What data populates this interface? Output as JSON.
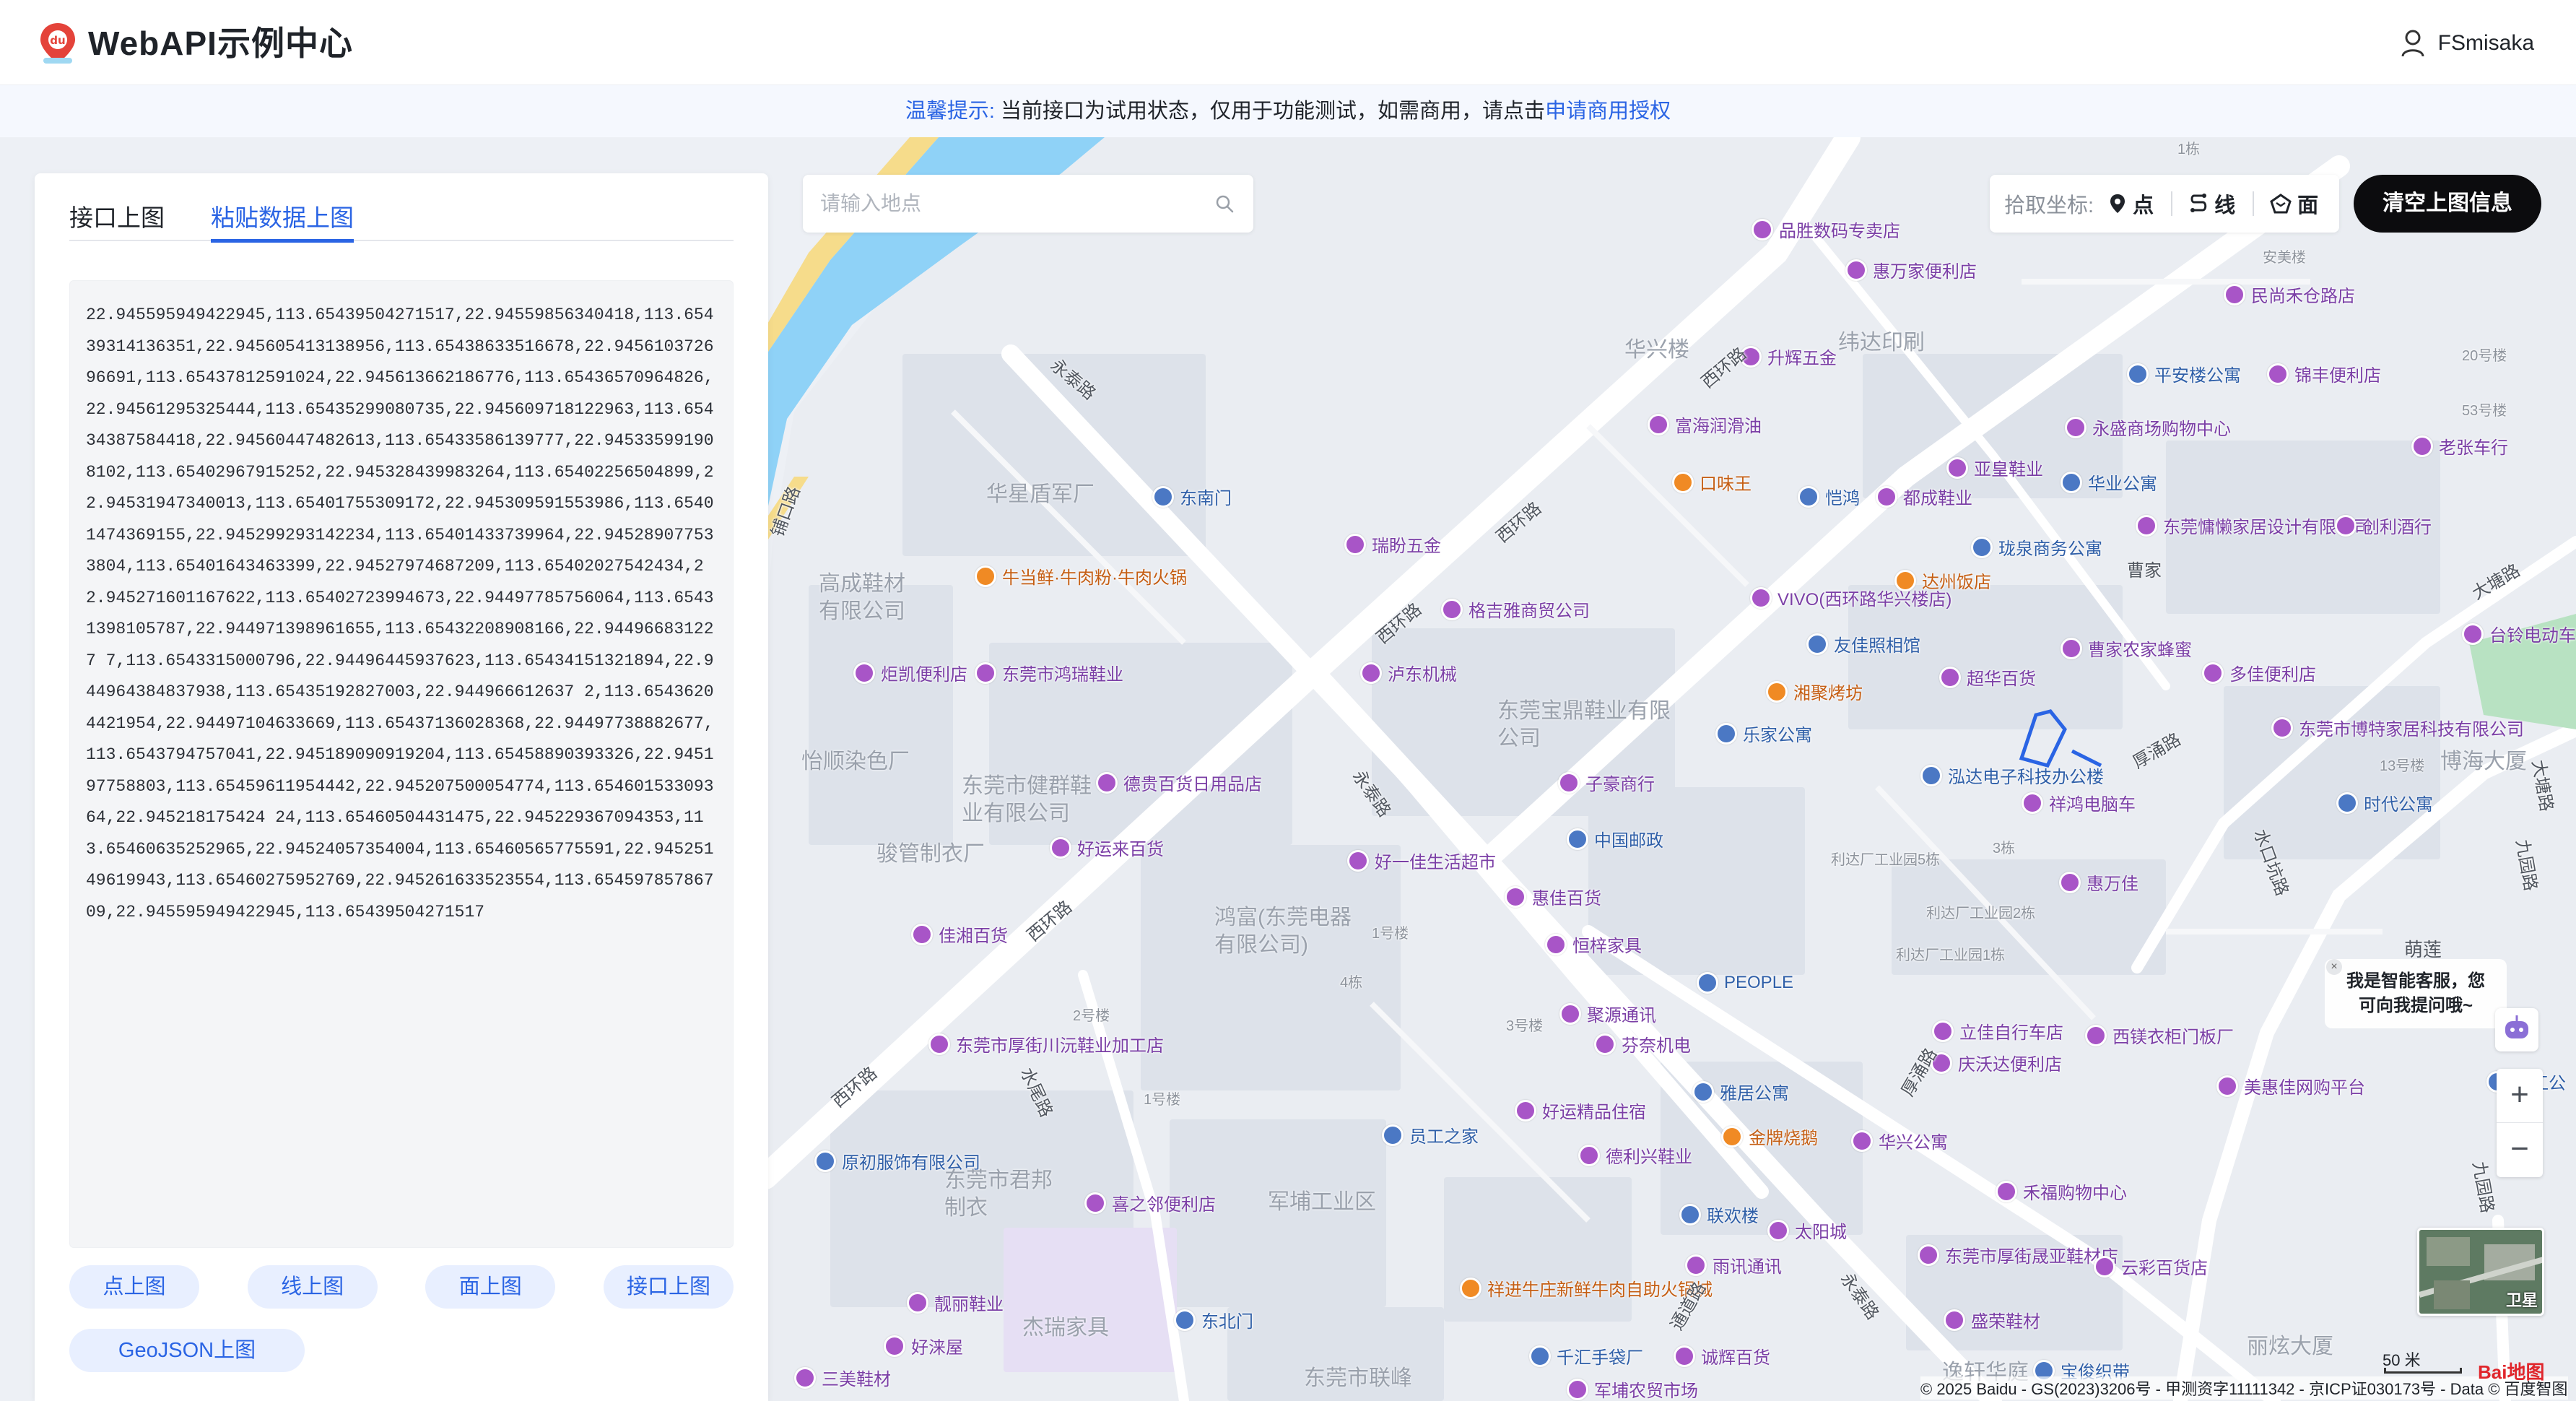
{
  "header": {
    "app_title": "WebAPI示例中心",
    "user_name": "FSmisaka",
    "logo_icon": "baidu-map-pin-icon",
    "user_icon": "user-icon"
  },
  "notice": {
    "label": "温馨提示:",
    "text": "当前接口为试用状态，仅用于功能测试，如需商用，请点击",
    "link": "申请商用授权"
  },
  "panel": {
    "tabs": [
      {
        "label": "接口上图",
        "active": false
      },
      {
        "label": "粘贴数据上图",
        "active": true
      }
    ],
    "coords_text": "22.945595949422945,113.65439504271517,22.94559856340418,113.65439314136351,22.945605413138956,113.65438633516678,22.945610372696691,113.65437812591024,22.945613662186776,113.65436570964826,22.94561295325444,113.65435299080735,22.945609718122963,113.65434387584418,22.94560447482613,113.65433586139777,22.945335991908102,113.65402967915252,22.945328439983264,113.65402256504899,22.94531947340013,113.65401755309172,22.945309591553986,113.65401474369155,22.945299293142234,113.65401433739964,22.945289077533804,113.65401643463399,22.94527974687209,113.65402027542434,22.945271601167622,113.65402723994673,22.94497785756064,113.65431398105787,22.944971398961655,113.65432208908166,22.944966831227 7,113.6543315000796,22.94496445937623,113.65434151321894,22.944964384837938,113.65435192827003,22.944966612637 2,113.65436204421954,22.94497104633669,113.65437136028368,22.94497738882677,113.6543794757041,22.945189090919204,113.65458890393326,22.945197758803,113.65459611954442,22.945207500054774,113.65460153309364,22.945218175424 24,113.65460504431475,22.945229367094353,113.65460635252965,22.94524057354004,113.65460565775591,22.94525149619943,113.65460275952769,22.945261633523554,113.65459785786709,22.945595949422945,113.65439504271517",
    "buttons": [
      "点上图",
      "线上图",
      "面上图",
      "接口上图"
    ],
    "geojson_button": "GeoJSON上图"
  },
  "search": {
    "placeholder": "请输入地点",
    "icon": "search-icon"
  },
  "pick_coords": {
    "label": "拾取坐标:",
    "options": [
      {
        "label": "点",
        "icon": "pin-icon"
      },
      {
        "label": "线",
        "icon": "route-icon"
      },
      {
        "label": "面",
        "icon": "polygon-icon"
      }
    ]
  },
  "clear_button": "清空上图信息",
  "chat_bubble": {
    "line1": "我是智能客服，您",
    "line2": "可向我提问哦~",
    "close": "×"
  },
  "zoom": {
    "in": "+",
    "out": "−"
  },
  "satellite_label": "卫星",
  "scale_label": "50 米",
  "copyright": "© 2025 Baidu - GS(2023)3206号 - 甲测资字11111342 - 京ICP证030173号 - Data © 百度智图",
  "baidu_logo": "Bai地图",
  "map_labels": {
    "pois": [
      {
        "text": "品胜数码专卖店",
        "type": "purple"
      },
      {
        "text": "惠万家便利店",
        "type": "purple"
      },
      {
        "text": "民尚禾仓路店",
        "type": "purple"
      },
      {
        "text": "升辉五金",
        "type": "purple"
      },
      {
        "text": "平安楼公寓",
        "type": "blue"
      },
      {
        "text": "锦丰便利店",
        "type": "purple"
      },
      {
        "text": "富海润滑油",
        "type": "purple"
      },
      {
        "text": "永盛商场购物中心",
        "type": "purple"
      },
      {
        "text": "老张车行",
        "type": "purple"
      },
      {
        "text": "口味王",
        "type": "orange"
      },
      {
        "text": "亚皇鞋业",
        "type": "purple"
      },
      {
        "text": "恺鸿",
        "type": "blue"
      },
      {
        "text": "都成鞋业",
        "type": "purple"
      },
      {
        "text": "华业公寓",
        "type": "blue"
      },
      {
        "text": "东莞慵懒家居设计有限公司",
        "type": "purple"
      },
      {
        "text": "创利酒行",
        "type": "purple"
      },
      {
        "text": "瑞盼五金",
        "type": "purple"
      },
      {
        "text": "珑泉商务公寓",
        "type": "blue"
      },
      {
        "text": "东南门",
        "type": "blue"
      },
      {
        "text": "牛当鲜·牛肉粉·牛肉火锅",
        "type": "orange"
      },
      {
        "text": "VIVO(西环路华兴楼店)",
        "type": "purple"
      },
      {
        "text": "达州饭店",
        "type": "orange"
      },
      {
        "text": "格吉雅商贸公司",
        "type": "purple"
      },
      {
        "text": "台铃电动车",
        "type": "purple"
      },
      {
        "text": "友佳照相馆",
        "type": "blue"
      },
      {
        "text": "炬凯便利店",
        "type": "purple"
      },
      {
        "text": "东莞市鸿瑞鞋业",
        "type": "purple"
      },
      {
        "text": "泸东机械",
        "type": "purple"
      },
      {
        "text": "湘聚烤坊",
        "type": "orange"
      },
      {
        "text": "超华百货",
        "type": "purple"
      },
      {
        "text": "曹家农家蜂蜜",
        "type": "purple"
      },
      {
        "text": "多佳便利店",
        "type": "purple"
      },
      {
        "text": "东莞市博特家居科技有限公司",
        "type": "purple"
      },
      {
        "text": "乐家公寓",
        "type": "blue"
      },
      {
        "text": "德贵百货日用品店",
        "type": "purple"
      },
      {
        "text": "子豪商行",
        "type": "purple"
      },
      {
        "text": "泓达电子科技办公楼",
        "type": "blue"
      },
      {
        "text": "祥鸿电脑车",
        "type": "purple"
      },
      {
        "text": "时代公寓",
        "type": "blue"
      },
      {
        "text": "好运来百货",
        "type": "purple"
      },
      {
        "text": "中国邮政",
        "type": "blue"
      },
      {
        "text": "好一佳生活超市",
        "type": "purple"
      },
      {
        "text": "惠佳百货",
        "type": "purple"
      },
      {
        "text": "惠万佳",
        "type": "purple"
      },
      {
        "text": "佳湘百货",
        "type": "purple"
      },
      {
        "text": "恒梓家具",
        "type": "purple"
      },
      {
        "text": "PEOPLE",
        "type": "blue"
      },
      {
        "text": "聚源通讯",
        "type": "purple"
      },
      {
        "text": "东莞市厚街川沅鞋业加工店",
        "type": "purple"
      },
      {
        "text": "芬奈机电",
        "type": "purple"
      },
      {
        "text": "立佳自行车店",
        "type": "purple"
      },
      {
        "text": "西镁衣柜门板厂",
        "type": "purple"
      },
      {
        "text": "庆沃达便利店",
        "type": "purple"
      },
      {
        "text": "雅居公寓",
        "type": "blue"
      },
      {
        "text": "美惠佳网购平台",
        "type": "purple"
      },
      {
        "text": "丽江公",
        "type": "blue"
      },
      {
        "text": "好运精品住宿",
        "type": "purple"
      },
      {
        "text": "员工之家",
        "type": "blue"
      },
      {
        "text": "原初服饰有限公司",
        "type": "blue"
      },
      {
        "text": "德利兴鞋业",
        "type": "purple"
      },
      {
        "text": "金牌烧鹅",
        "type": "orange"
      },
      {
        "text": "华兴公寓",
        "type": "purple"
      },
      {
        "text": "禾福购物中心",
        "type": "purple"
      },
      {
        "text": "喜之邻便利店",
        "type": "purple"
      },
      {
        "text": "联欢楼",
        "type": "blue"
      },
      {
        "text": "太阳城",
        "type": "purple"
      },
      {
        "text": "东莞市厚街晟亚鞋材店",
        "type": "purple"
      },
      {
        "text": "云彩百货店",
        "type": "purple"
      },
      {
        "text": "雨讯通讯",
        "type": "purple"
      },
      {
        "text": "祥进牛庄新鲜牛肉自助火锅城",
        "type": "orange"
      },
      {
        "text": "靓丽鞋业",
        "type": "purple"
      },
      {
        "text": "东北门",
        "type": "blue"
      },
      {
        "text": "盛荣鞋材",
        "type": "purple"
      },
      {
        "text": "好涞屋",
        "type": "purple"
      },
      {
        "text": "千汇手袋厂",
        "type": "blue"
      },
      {
        "text": "诚辉百货",
        "type": "purple"
      },
      {
        "text": "宝俊织带",
        "type": "blue"
      },
      {
        "text": "三美鞋材",
        "type": "purple"
      },
      {
        "text": "军埔农贸市场",
        "type": "purple"
      }
    ],
    "areas": [
      "华兴楼",
      "纬达印刷",
      "华星盾军厂",
      "高成鞋材有限公司",
      "东莞宝鼎鞋业有限公司",
      "怡顺染色厂",
      "东莞市健群鞋业有限公司",
      "骏管制衣厂",
      "鸿富(东莞电器有限公司)",
      "东莞市君邦制衣",
      "军埔工业区",
      "杰瑞家具",
      "东莞市联峰",
      "逸轩华庭",
      "丽炫大厦",
      "博海大厦",
      "曹家",
      "萌莲"
    ],
    "roads": [
      "西环路",
      "西环路",
      "西环路",
      "西环路",
      "西环路",
      "永泰路",
      "永泰路",
      "永泰路",
      "水尾路",
      "厚涌路",
      "厚涌路",
      "水口坑路",
      "大塘路",
      "九园路",
      "九园路",
      "大塘路",
      "铺口路",
      "通道路"
    ],
    "small": [
      "1号楼",
      "2号楼",
      "3号楼",
      "4栋",
      "1号楼",
      "利达厂工业园5栋",
      "利达厂工业园2栋",
      "利达厂工业园1栋",
      "3栋",
      "13号楼",
      "20号楼",
      "53号楼",
      "安美楼",
      "1栋"
    ]
  }
}
